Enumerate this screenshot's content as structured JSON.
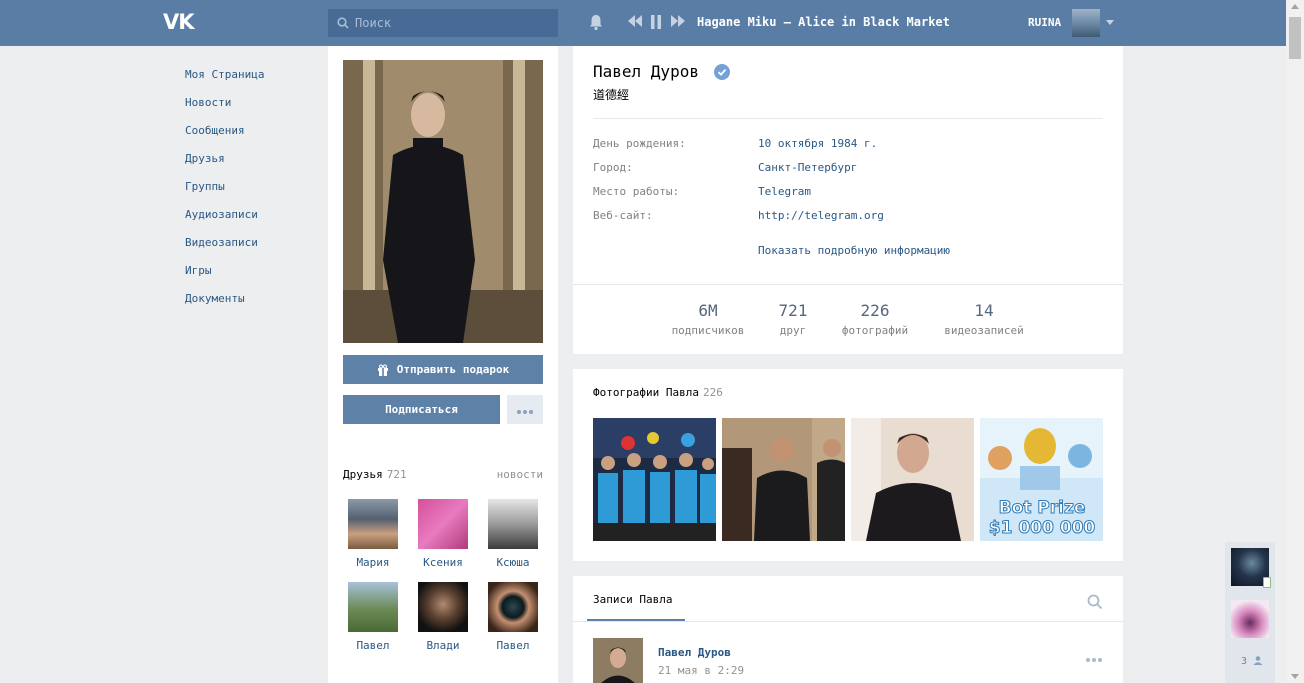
{
  "header": {
    "search_placeholder": "Поиск",
    "now_playing": "Hagane Miku – Alice in Black Market",
    "username": "RUINA"
  },
  "nav": [
    "Моя Страница",
    "Новости",
    "Сообщения",
    "Друзья",
    "Группы",
    "Аудиозаписи",
    "Видеозаписи",
    "Игры",
    "Документы"
  ],
  "actions": {
    "gift": "Отправить подарок",
    "subscribe": "Подписаться"
  },
  "friends": {
    "title": "Друзья",
    "count": "721",
    "news": "новости",
    "items": [
      "Мария",
      "Ксения",
      "Ксюша",
      "Павел",
      "Влади",
      "Павел"
    ]
  },
  "profile": {
    "name": "Павел Дуров",
    "status": "道德經",
    "fields": [
      {
        "label": "День рождения:",
        "value": "10 октября 1984 г."
      },
      {
        "label": "Город:",
        "value": "Санкт-Петербург"
      },
      {
        "label": "Место работы:",
        "value": "Telegram"
      },
      {
        "label": "Веб-сайт:",
        "value": "http://telegram.org"
      }
    ],
    "more_info": "Показать подробную информацию",
    "counters": [
      {
        "num": "6M",
        "label": "подписчиков"
      },
      {
        "num": "721",
        "label": "друг"
      },
      {
        "num": "226",
        "label": "фотографий"
      },
      {
        "num": "14",
        "label": "видеозаписей"
      }
    ]
  },
  "photos": {
    "title": "Фотографии Павла",
    "count": "226",
    "banner_text1": "Bot Prize",
    "banner_text2": "$1 000 000"
  },
  "wall": {
    "tab": "Записи Павла",
    "post_author": "Павел Дуров",
    "post_date": "21 мая в 2:29"
  },
  "chat": {
    "online_count": "3"
  }
}
